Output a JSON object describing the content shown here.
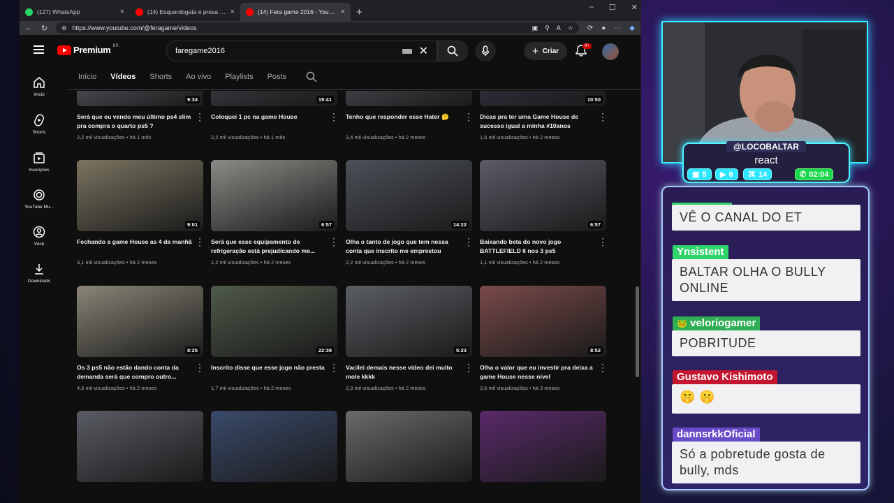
{
  "browser": {
    "tabs": [
      {
        "title": "(127) WhatsApp",
        "color": "#25d366"
      },
      {
        "title": "(14) Esquerdogata é presa após d",
        "color": "#ff0000"
      },
      {
        "title": "(14) Fera game 2016 - YouTube",
        "color": "#ff0000"
      }
    ],
    "url": "https://www.youtube.com/@feragame/videos"
  },
  "youtube": {
    "logo": "Premium",
    "logo_country": "BR",
    "search_value": "faregame2016",
    "create_label": "Criar",
    "notif_count": "9+",
    "guide": [
      "Início",
      "Shorts",
      "Inscrições",
      "YouTube Mu...",
      "Você",
      "Downloads"
    ],
    "channel_tabs": [
      "Início",
      "Vídeos",
      "Shorts",
      "Ao vivo",
      "Playlists",
      "Posts"
    ],
    "videos": [
      {
        "title": "Será que eu vendo meu último ps4 slim pra compra o quarto ps5 ?",
        "views": "2,2 mil visualizações",
        "age": "há 1 mês",
        "duration": "9:34"
      },
      {
        "title": "Coloquei 1 pc na game House",
        "views": "2,2 mil visualizações",
        "age": "há 1 mês",
        "duration": "19:41"
      },
      {
        "title": "Tenho que responder esse Hater 🤔",
        "views": "3,4 mil visualizações",
        "age": "há 2 meses",
        "duration": ""
      },
      {
        "title": "Dicas pra ter uma Game House de sucesso igual a minha #10anos",
        "views": "1,6 mil visualizações",
        "age": "há 2 meses",
        "duration": "10:50"
      },
      {
        "title": "Fechando a game House as 4 da manhã",
        "views": "3,1 mil visualizações",
        "age": "há 2 meses",
        "duration": "9:01"
      },
      {
        "title": "Será que esse equipamento de refrigeração está prejudicando me...",
        "views": "1,2 mil visualizações",
        "age": "há 2 meses",
        "duration": "6:57"
      },
      {
        "title": "Olha o tanto de jogo que tem nessa conta que inscrito me emprestou",
        "views": "2,2 mil visualizações",
        "age": "há 2 meses",
        "duration": "14:22"
      },
      {
        "title": "Baixando beta do novo jogo BATTLEFIELD 6 nos 3 ps5",
        "views": "1,1 mil visualizações",
        "age": "há 2 meses",
        "duration": "6:57"
      },
      {
        "title": "Os 3 ps5 não estão dando conta da demanda será que compro outro...",
        "views": "4,6 mil visualizações",
        "age": "há 2 meses",
        "duration": "8:25"
      },
      {
        "title": "Inscrito disse que esse jogo não presta",
        "views": "1,7 mil visualizações",
        "age": "há 2 meses",
        "duration": "22:39"
      },
      {
        "title": "Vacilei demais nesse vídeo dei muito mole kkkk",
        "views": "2,3 mil visualizações",
        "age": "há 2 meses",
        "duration": "5:23"
      },
      {
        "title": "Olha o valor que eu investir pra deixa a game House nesse nível",
        "views": "3,6 mil visualizações",
        "age": "há 3 meses",
        "duration": "8:52"
      }
    ],
    "thumb_colors": [
      "#6b6f7a",
      "#4a4b55",
      "#5a5f67",
      "#3c3d52",
      "#7a7460",
      "#8c8a86",
      "#4c5058",
      "#5a5b66",
      "#8a8577",
      "#4f5a4a",
      "#5b5e63",
      "#7a4a4a",
      "#5a5c64",
      "#3a4a6a",
      "#6a6a6a",
      "#5a2a6a"
    ]
  },
  "stream": {
    "handle": "@LOCOBALTAR",
    "activity": "react",
    "stats": [
      "5",
      "6",
      "14",
      "02:04"
    ],
    "chat": [
      {
        "name": "",
        "msg": "VÊ O CANAL DO ET",
        "color": "#2fd46a"
      },
      {
        "name": "Ynsistent",
        "msg": "BALTAR OLHA O BULLY ONLINE",
        "color": "#2fd46a"
      },
      {
        "name": "veloriogamer",
        "msg": "POBRITUDE",
        "color": "#2fae55"
      },
      {
        "name": "Gustavo Kishimoto",
        "msg": "🤫 🤫",
        "color": "#c5162f"
      },
      {
        "name": "dannsrkkOficial",
        "msg": "Só a pobretude gosta de bully, mds",
        "color": "#6a4bc8"
      }
    ]
  }
}
